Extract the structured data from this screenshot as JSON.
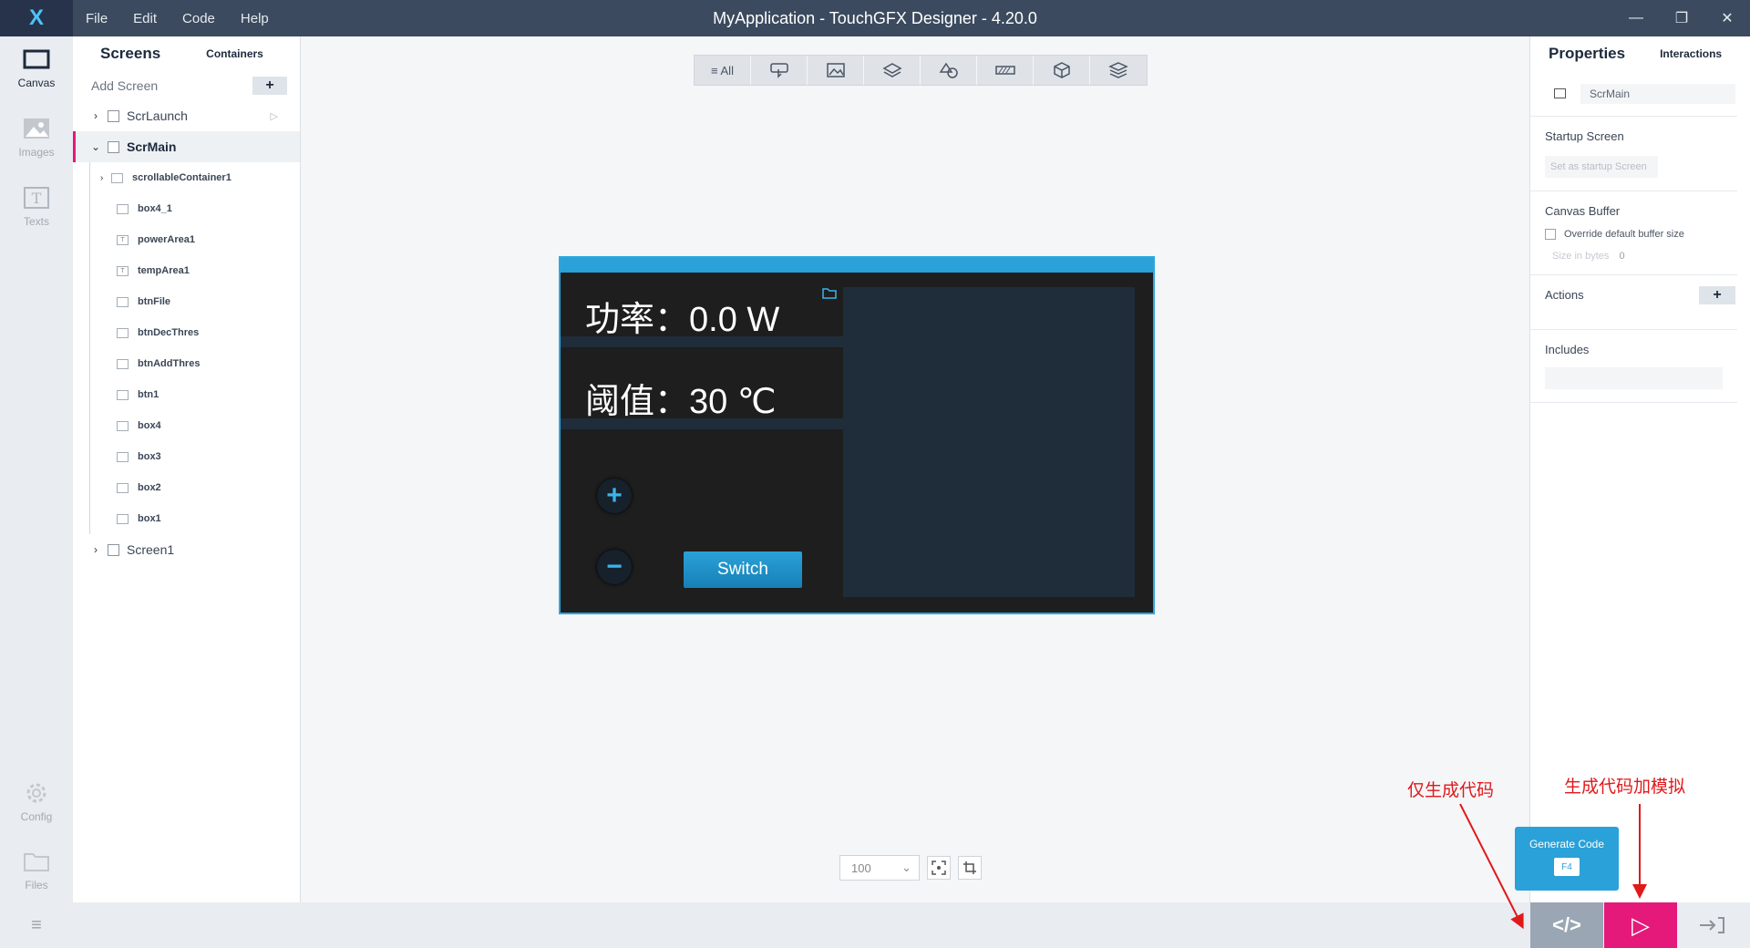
{
  "window": {
    "logo": "X",
    "title": "MyApplication - TouchGFX Designer - 4.20.0",
    "menu": [
      "File",
      "Edit",
      "Code",
      "Help"
    ],
    "controls": [
      "—",
      "❐",
      "✕"
    ]
  },
  "rail": {
    "items": [
      {
        "label": "Canvas",
        "icon": "canvas-icon"
      },
      {
        "label": "Images",
        "icon": "image-icon"
      },
      {
        "label": "Texts",
        "icon": "text-icon"
      },
      {
        "label": "Config",
        "icon": "gear-icon"
      },
      {
        "label": "Files",
        "icon": "folder-icon"
      }
    ],
    "bottom_icon": "≡"
  },
  "screens_panel": {
    "tab_screens": "Screens",
    "tab_containers": "Containers",
    "add_screen": "Add Screen",
    "add_plus": "+",
    "screens": [
      {
        "name": "ScrLaunch",
        "expanded": false
      },
      {
        "name": "ScrMain",
        "expanded": true,
        "selected": true
      },
      {
        "name": "Screen1",
        "expanded": false
      }
    ],
    "scrmain_children": [
      "scrollableContainer1",
      "box4_1",
      "powerArea1",
      "tempArea1",
      "btnFile",
      "btnDecThres",
      "btnAddThres",
      "btn1",
      "box4",
      "box3",
      "box2",
      "box1"
    ]
  },
  "toolbar": {
    "filters": [
      "≡ All",
      "",
      "",
      "",
      "",
      "",
      "",
      ""
    ]
  },
  "device": {
    "power_text": "功率：0.0 W",
    "threshold_text": "阈值：30 ℃",
    "plus_label": "+",
    "minus_label": "−",
    "switch_label": "Switch"
  },
  "zoom": {
    "value": "100"
  },
  "properties": {
    "tab_properties": "Properties",
    "tab_interactions": "Interactions",
    "screen_name": "ScrMain",
    "startup_header": "Startup Screen",
    "startup_button": "Set as startup Screen",
    "canvas_buffer_header": "Canvas Buffer",
    "override_label": "Override default buffer size",
    "size_label": "Size in bytes",
    "size_value": "0",
    "actions_header": "Actions",
    "actions_plus": "+",
    "includes_header": "Includes"
  },
  "bottom": {
    "generate_code_tooltip": "Generate Code",
    "generate_code_key": "F4",
    "generate_icon": "</>",
    "run_icon": "▷"
  },
  "annotations": {
    "code_only": "仅生成代码",
    "code_and_sim": "生成代码加模拟"
  },
  "colors": {
    "accent": "#2aa1d8",
    "run": "#e4197a",
    "titlebar": "#3b4a5e"
  }
}
